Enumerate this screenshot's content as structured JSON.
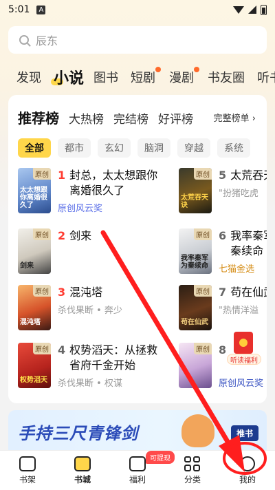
{
  "status_bar": {
    "time": "5:01",
    "notification": "A"
  },
  "search": {
    "placeholder": "辰东"
  },
  "channel_tabs": [
    "发现",
    "小说",
    "图书",
    "短剧",
    "漫剧",
    "书友圈",
    "听书"
  ],
  "rank": {
    "tabs": [
      "推荐榜",
      "大热榜",
      "完结榜",
      "好评榜"
    ],
    "more": "完整榜单 ›",
    "filters": [
      "全部",
      "都市",
      "玄幻",
      "脑洞",
      "穿越",
      "系统"
    ],
    "books": [
      {
        "rank": "1",
        "title": "封总，太太想跟你离婚很久了",
        "tag": "原创风云奖",
        "badge": "原创",
        "cover_text": "太太想跟你离婚很久了"
      },
      {
        "rank": "2",
        "title": "剑来",
        "tag": "",
        "badge": "原创",
        "cover_text": "剑来"
      },
      {
        "rank": "3",
        "title": "混沌塔",
        "tag": "杀伐果断 • 奔少",
        "badge": "原创",
        "cover_text": "混沌塔"
      },
      {
        "rank": "4",
        "title": "权势滔天：从拯救省府千金开始",
        "tag": "杀伐果断 • 权谋",
        "badge": "原创",
        "cover_text": "权势滔天"
      },
      {
        "rank": "5",
        "title": "太荒吞天",
        "tag": "\"扮猪吃虎",
        "badge": "原创",
        "cover_text": "太荒吞天诀"
      },
      {
        "rank": "6",
        "title": "我率秦军为秦续命",
        "tag": "七猫金选",
        "badge": "原创",
        "cover_text": "我率秦军为秦续命"
      },
      {
        "rank": "7",
        "title": "苟在仙武生",
        "tag": "\"热情洋溢",
        "badge": "原创",
        "cover_text": "苟在仙武"
      },
      {
        "rank": "8",
        "title": "",
        "tag": "原创风云奖",
        "badge": "原创",
        "cover_text": ""
      }
    ]
  },
  "redpack": {
    "label": "听读福利"
  },
  "banner": {
    "text": "手持三尺青锋剑",
    "button": "推书"
  },
  "bottom_nav": {
    "items": [
      "书架",
      "书城",
      "福利",
      "分类",
      "我的"
    ],
    "badge": "可提现"
  }
}
